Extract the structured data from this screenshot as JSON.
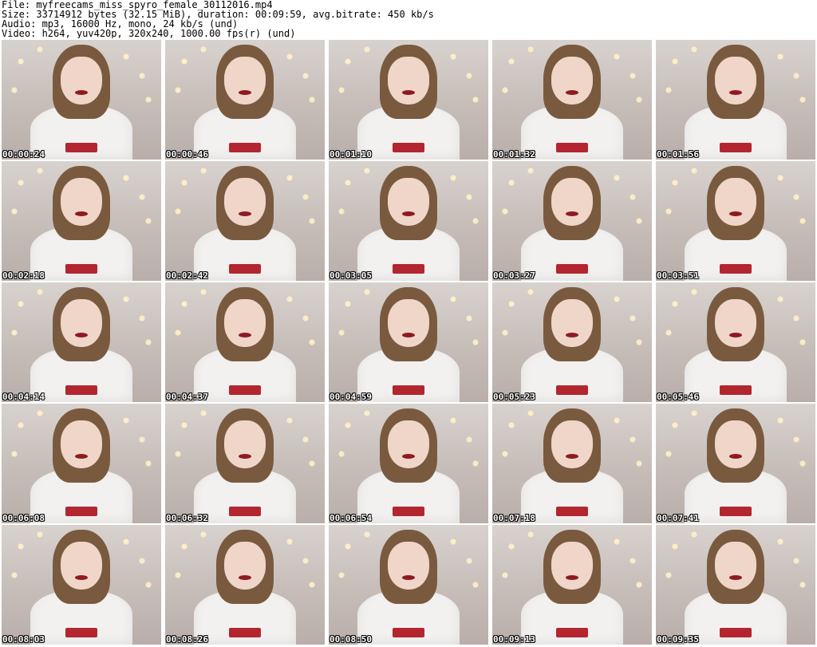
{
  "header": {
    "file": "File: myfreecams_miss_spyro_female_30112016.mp4",
    "size": "Size: 33714912 bytes (32.15 MiB), duration: 00:09:59, avg.bitrate: 450 kb/s",
    "audio": "Audio: mp3, 16000 Hz, mono, 24 kb/s (und)",
    "video": "Video: h264, yuv420p, 320x240, 1000.00 fps(r) (und)"
  },
  "thumbnails": [
    {
      "time": "00:00:24"
    },
    {
      "time": "00:00:46"
    },
    {
      "time": "00:01:10"
    },
    {
      "time": "00:01:32"
    },
    {
      "time": "00:01:56"
    },
    {
      "time": "00:02:18"
    },
    {
      "time": "00:02:42"
    },
    {
      "time": "00:03:05"
    },
    {
      "time": "00:03:27"
    },
    {
      "time": "00:03:51"
    },
    {
      "time": "00:04:14"
    },
    {
      "time": "00:04:37"
    },
    {
      "time": "00:04:59"
    },
    {
      "time": "00:05:23"
    },
    {
      "time": "00:05:46"
    },
    {
      "time": "00:06:08"
    },
    {
      "time": "00:06:32"
    },
    {
      "time": "00:06:54"
    },
    {
      "time": "00:07:18"
    },
    {
      "time": "00:07:41"
    },
    {
      "time": "00:08:03"
    },
    {
      "time": "00:08:26"
    },
    {
      "time": "00:08:50"
    },
    {
      "time": "00:09:13"
    },
    {
      "time": "00:09:35"
    }
  ]
}
